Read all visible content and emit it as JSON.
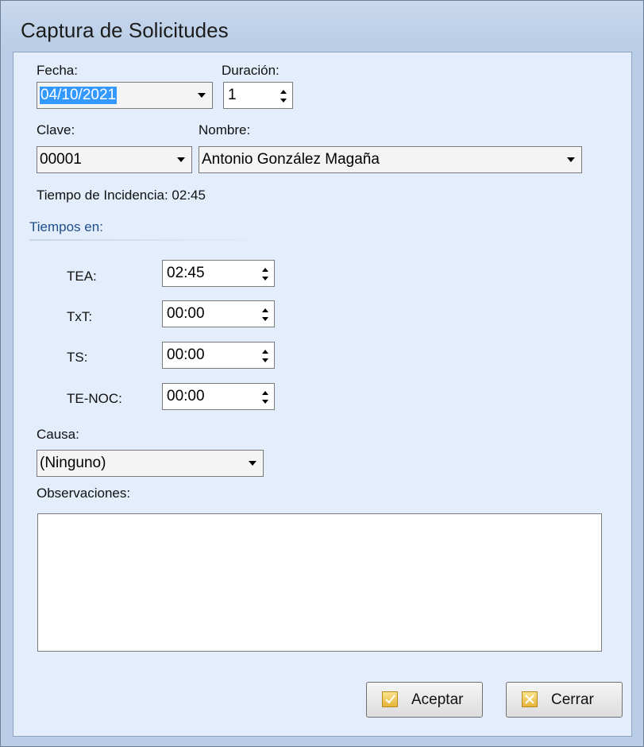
{
  "window": {
    "title": "Captura de Solicitudes"
  },
  "fecha": {
    "label": "Fecha:",
    "value": "04/10/2021"
  },
  "duracion": {
    "label": "Duración:",
    "value": "1"
  },
  "clave": {
    "label": "Clave:",
    "value": "00001"
  },
  "nombre": {
    "label": "Nombre:",
    "value": "Antonio González Magaña"
  },
  "tiempo_incidencia": {
    "label": "Tiempo de Incidencia:",
    "value": "02:45"
  },
  "tiempos": {
    "title": "Tiempos en:",
    "rows": [
      {
        "label": "TEA:",
        "value": "02:45"
      },
      {
        "label": "TxT:",
        "value": "00:00"
      },
      {
        "label": "TS:",
        "value": "00:00"
      },
      {
        "label": "TE-NOC:",
        "value": "00:00"
      }
    ]
  },
  "causa": {
    "label": "Causa:",
    "value": "(Ninguno)"
  },
  "observaciones": {
    "label": "Observaciones:",
    "value": ""
  },
  "buttons": {
    "accept": "Aceptar",
    "close": "Cerrar"
  },
  "icons": {
    "accept": "checkbox-check-icon",
    "close": "checkbox-x-icon"
  },
  "colors": {
    "selection": "#3399ff",
    "section_title": "#1f4e8c",
    "client_bg": "#e3edfb"
  }
}
